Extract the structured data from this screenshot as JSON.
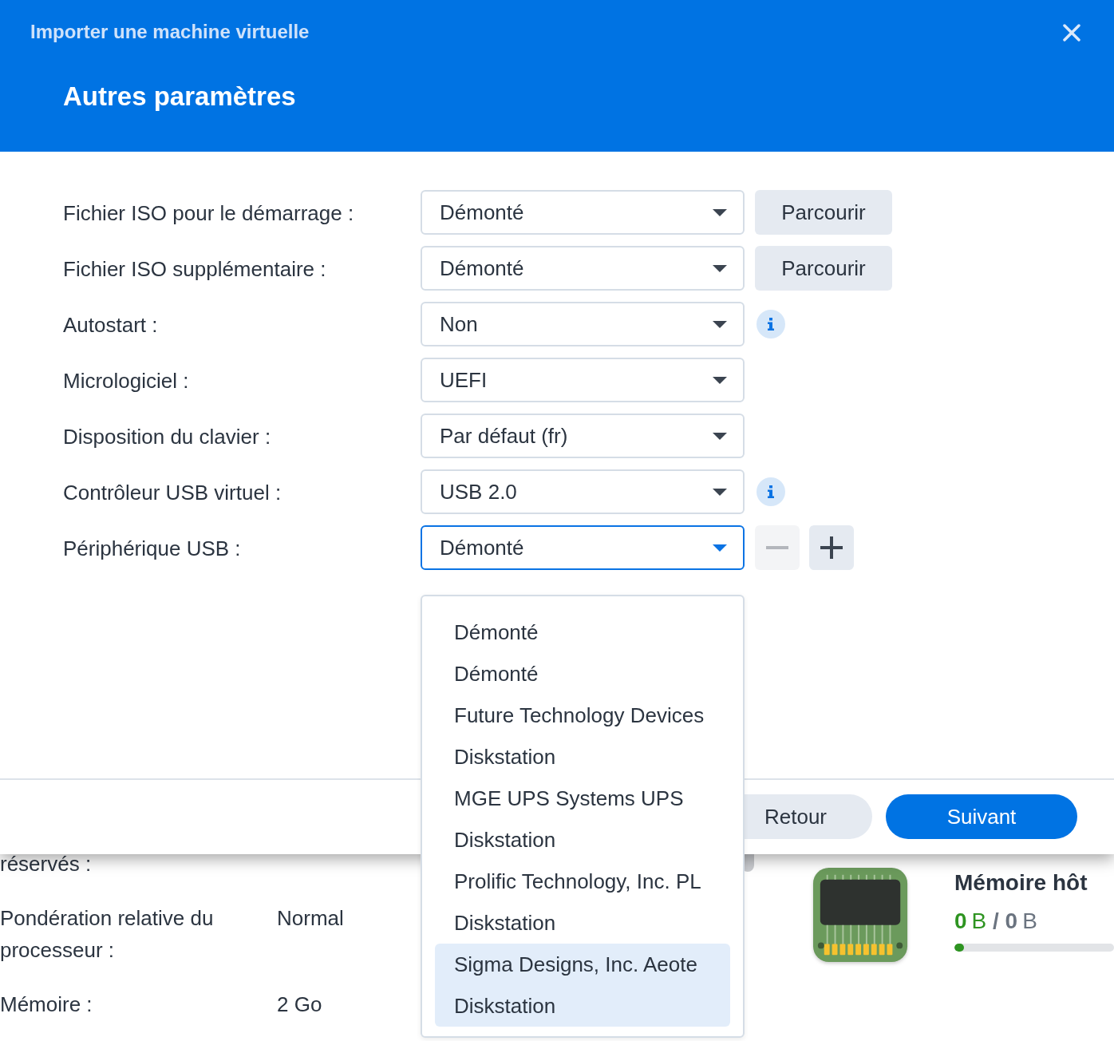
{
  "dialog": {
    "title": "Importer une machine virtuelle",
    "heading": "Autres paramètres",
    "fields": [
      {
        "label": "Fichier ISO pour le démarrage :",
        "value": "Démonté",
        "focused": false,
        "trailing": {
          "kind": "browse",
          "label": "Parcourir"
        }
      },
      {
        "label": "Fichier ISO supplémentaire :",
        "value": "Démonté",
        "focused": false,
        "trailing": {
          "kind": "browse",
          "label": "Parcourir"
        }
      },
      {
        "label": "Autostart :",
        "value": "Non",
        "focused": false,
        "trailing": {
          "kind": "info"
        }
      },
      {
        "label": "Micrologiciel :",
        "value": "UEFI",
        "focused": false
      },
      {
        "label": "Disposition du clavier :",
        "value": "Par défaut (fr)",
        "focused": false
      },
      {
        "label": "Contrôleur USB virtuel :",
        "value": "USB 2.0",
        "focused": false,
        "trailing": {
          "kind": "info"
        }
      },
      {
        "label": "Périphérique USB :",
        "value": "Démonté",
        "focused": true,
        "trailing": {
          "kind": "add_remove",
          "remove_disabled": true
        }
      }
    ],
    "dropdown": {
      "options": [
        {
          "label": "Démonté\nDémonté",
          "selected": false
        },
        {
          "label": "Future Technology Devices\nDiskstation",
          "selected": false
        },
        {
          "label": "MGE UPS Systems UPS\nDiskstation",
          "selected": false
        },
        {
          "label": "Prolific Technology, Inc. PL\nDiskstation",
          "selected": false
        },
        {
          "label": "Sigma Designs, Inc. Aeote\nDiskstation",
          "selected": true
        }
      ]
    },
    "footer": {
      "buttons": [
        {
          "label": "Retour",
          "kind": "secondary"
        },
        {
          "label": "Suivant",
          "kind": "primary"
        }
      ]
    }
  },
  "background": {
    "settings": [
      {
        "label": "réservés :"
      },
      {
        "label": "Pondération relative du processeur :",
        "value": "Normal"
      },
      {
        "label": "Mémoire :",
        "value": "2 Go"
      }
    ],
    "host_memory": {
      "title": "Mémoire hôt",
      "used": "0",
      "used_unit": "B",
      "separator": "/",
      "total": "0",
      "total_unit": "B",
      "level": 0.06
    }
  }
}
